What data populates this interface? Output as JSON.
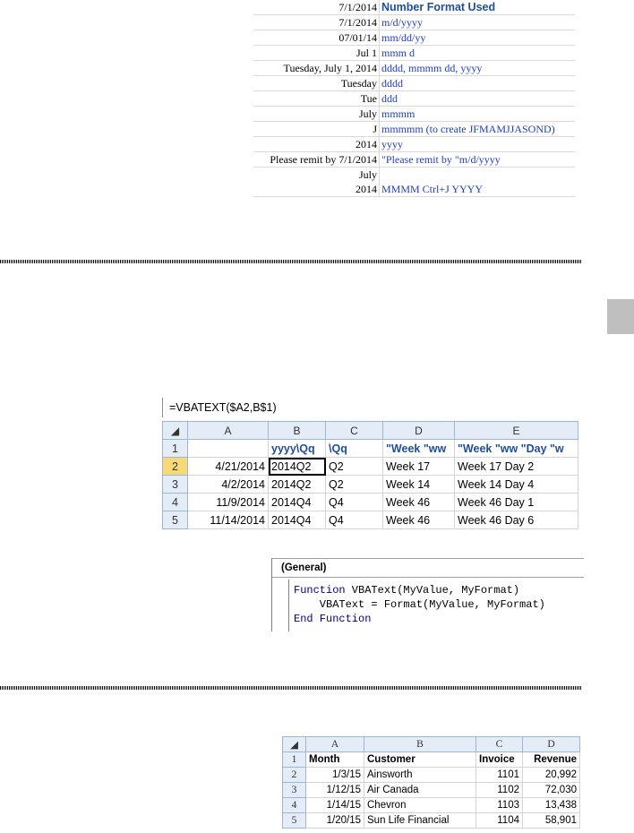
{
  "format_table": {
    "header": {
      "value": "7/1/2014",
      "format": "Number Format Used"
    },
    "rows": [
      {
        "value": "7/1/2014",
        "format": "m/d/yyyy"
      },
      {
        "value": "07/01/14",
        "format": "mm/dd/yy"
      },
      {
        "value": "Jul 1",
        "format": "mmm d"
      },
      {
        "value": "Tuesday, July 1, 2014",
        "format": "dddd, mmmm dd, yyyy"
      },
      {
        "value": "Tuesday",
        "format": "dddd"
      },
      {
        "value": "Tue",
        "format": "ddd"
      },
      {
        "value": "July",
        "format": "mmmm"
      },
      {
        "value": "J",
        "format": "mmmmm (to create JFMAMJJASOND)"
      },
      {
        "value": "2014",
        "format": "yyyy"
      },
      {
        "value": "Please remit by 7/1/2014",
        "format": "\"Please remit by \"m/d/yyyy"
      },
      {
        "value": "July",
        "format": ""
      },
      {
        "value": "2014",
        "format": "MMMM Ctrl+J YYYY"
      }
    ]
  },
  "excel1": {
    "formula": "=VBATEXT($A2,B$1)",
    "columns": [
      "A",
      "B",
      "C",
      "D",
      "E"
    ],
    "header_row": {
      "num": "1",
      "cells": [
        "",
        "yyyy\\Qq",
        "\\Qq",
        "\"Week \"ww",
        "\"Week \"ww \"Day \"w"
      ]
    },
    "rows": [
      {
        "num": "2",
        "cells": [
          "4/21/2014",
          "2014Q2",
          "Q2",
          "Week 17",
          "Week 17 Day 2"
        ]
      },
      {
        "num": "3",
        "cells": [
          "4/2/2014",
          "2014Q2",
          "Q2",
          "Week 14",
          "Week 14 Day 4"
        ]
      },
      {
        "num": "4",
        "cells": [
          "11/9/2014",
          "2014Q4",
          "Q4",
          "Week 46",
          "Week 46 Day 1"
        ]
      },
      {
        "num": "5",
        "cells": [
          "11/14/2014",
          "2014Q4",
          "Q4",
          "Week 46",
          "Week 46 Day 6"
        ]
      }
    ]
  },
  "vba": {
    "dropdown": "(General)",
    "line1_kw": "Function",
    "line1_rest": " VBAText(MyValue, MyFormat)",
    "line2": "    VBAText = Format(MyValue, MyFormat)",
    "line3_kw": "End Function"
  },
  "excel2": {
    "columns": [
      "A",
      "B",
      "C",
      "D"
    ],
    "header_row": {
      "num": "1",
      "cells": [
        "Month",
        "Customer",
        "Invoice",
        "Revenue"
      ]
    },
    "rows": [
      {
        "num": "2",
        "cells": [
          "1/3/15",
          "Ainsworth",
          "1101",
          "20,992"
        ]
      },
      {
        "num": "3",
        "cells": [
          "1/12/15",
          "Air Canada",
          "1102",
          "72,030"
        ]
      },
      {
        "num": "4",
        "cells": [
          "1/14/15",
          "Chevron",
          "1103",
          "13,438"
        ]
      },
      {
        "num": "5",
        "cells": [
          "1/20/15",
          "Sun Life Financial",
          "1104",
          "58,901"
        ]
      }
    ]
  }
}
